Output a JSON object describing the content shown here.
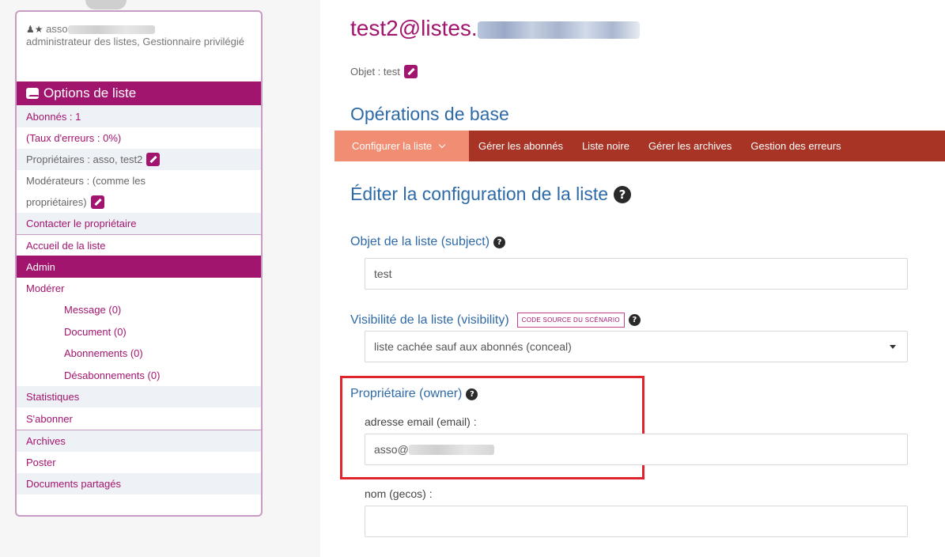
{
  "sidebar": {
    "user_prefix": "asso",
    "user_role": "administrateur des listes, Gestionnaire privilégié",
    "options_header": "Options de liste",
    "items": [
      {
        "label": "Abonnés : 1"
      },
      {
        "label": "(Taux d'erreurs : 0%)"
      },
      {
        "label": "Propriétaires : asso, test2"
      },
      {
        "label": "Modérateurs : (comme les"
      },
      {
        "label": "propriétaires)"
      },
      {
        "label": "Contacter le propriétaire"
      },
      {
        "label": "Accueil de la liste"
      },
      {
        "label": "Admin"
      },
      {
        "label": "Modérer"
      },
      {
        "label": "Message (0)"
      },
      {
        "label": "Document (0)"
      },
      {
        "label": "Abonnements (0)"
      },
      {
        "label": "Désabonnements (0)"
      },
      {
        "label": "Statistiques"
      },
      {
        "label": "S'abonner"
      },
      {
        "label": "Archives"
      },
      {
        "label": "Poster"
      },
      {
        "label": "Documents partagés"
      }
    ]
  },
  "main": {
    "title_prefix": "test2@listes.",
    "objet_label": "Objet : test",
    "operations_heading": "Opérations de base",
    "tabs": [
      {
        "label": "Configurer la liste"
      },
      {
        "label": "Gérer les abonnés"
      },
      {
        "label": "Liste noire"
      },
      {
        "label": "Gérer les archives"
      },
      {
        "label": "Gestion des erreurs"
      }
    ],
    "edit_heading": "Éditer la configuration de la liste",
    "subject_label": "Objet de la liste (subject)",
    "subject_value": "test",
    "visibility_label": "Visibilité de la liste (visibility)",
    "scenario_button": "CODE SOURCE DU SCÉNARIO",
    "visibility_value": "liste cachée sauf aux abonnés (conceal)",
    "owner_label": "Propriétaire (owner)",
    "email_label": "adresse email (email) :",
    "email_value_prefix": "asso@",
    "gecos_label": "nom (gecos) :",
    "gecos_value": ""
  },
  "icons": {
    "help": "?",
    "help_icon": "question-circle-icon",
    "edit_icon": "pencil-icon",
    "envelope_icon": "envelope-icon",
    "user_icon": "user-icon",
    "star_icon": "star-icon"
  },
  "colors": {
    "brand_magenta": "#a2156f",
    "heading_blue": "#2f6aa8",
    "navbar_red": "#a73425",
    "navbar_active": "#f08d72",
    "highlight_red": "#e0242e"
  }
}
